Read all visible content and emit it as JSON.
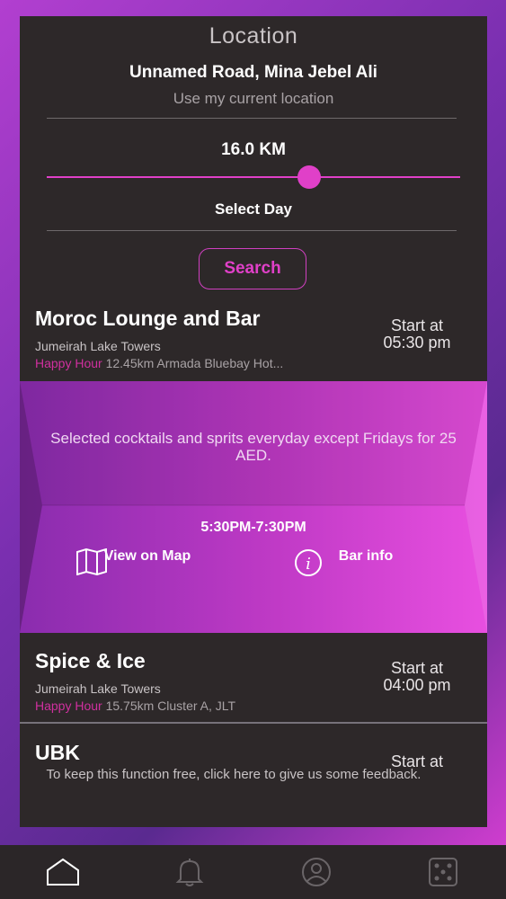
{
  "location": {
    "title": "Location",
    "address": "Unnamed Road, Mina Jebel Ali",
    "use_current": "Use my current location"
  },
  "filter": {
    "distance": "16.0 KM",
    "distance_level_fraction": 0.64,
    "select_day": "Select Day",
    "search_label": "Search"
  },
  "venues": [
    {
      "name": "Moroc Lounge and Bar",
      "area": "Jumeirah Lake Towers",
      "tag": "Happy Hour",
      "detail": " 12.45km Armada Bluebay Hot...",
      "start_label": "Start at",
      "start_time": "05:30 pm"
    },
    {
      "name": "Spice & Ice",
      "area": "Jumeirah Lake Towers",
      "tag": "Happy Hour",
      "detail": " 15.75km Cluster A, JLT",
      "start_label": "Start at",
      "start_time": "04:00 pm"
    },
    {
      "name": "UBK",
      "start_label": "Start at"
    }
  ],
  "deal": {
    "description": "Selected cocktails and sprits everyday except Fridays for 25 AED.",
    "time": "5:30PM-7:30PM",
    "map_label": "View on Map",
    "info_label": "Bar info"
  },
  "feedback": "To keep this function free, click here to give us some feedback.",
  "tabbar": {
    "icons": [
      "home-icon",
      "bell-icon",
      "profile-icon",
      "dice-icon"
    ],
    "active": "home-icon"
  },
  "colors": {
    "accent": "#e040c8",
    "panel": "#2d2829"
  }
}
